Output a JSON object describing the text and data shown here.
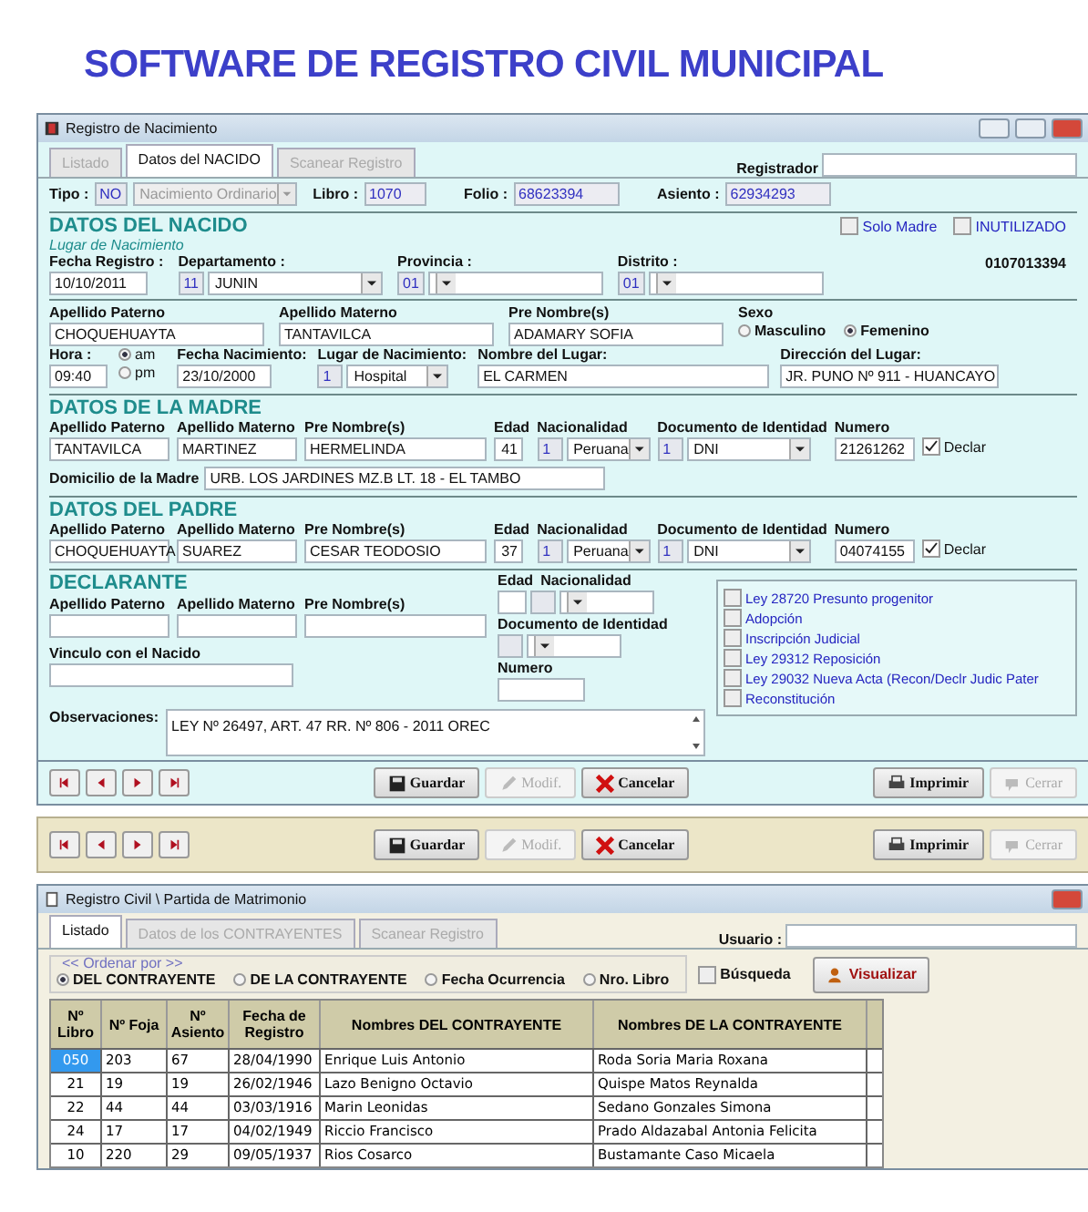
{
  "heading": "SOFTWARE DE REGISTRO CIVIL MUNICIPAL",
  "birth_window": {
    "title": "Registro de Nacimiento",
    "tabs": [
      {
        "label": "Listado",
        "selected": false
      },
      {
        "label": "Datos del NACIDO",
        "selected": true
      },
      {
        "label": "Scanear Registro",
        "selected": false
      }
    ],
    "registrador_label": "Registrador",
    "tipo": {
      "label": "Tipo :",
      "code": "NO",
      "value": "Nacimiento Ordinario"
    },
    "libro": {
      "label": "Libro :",
      "value": "1070"
    },
    "folio": {
      "label": "Folio :",
      "value": "68623394"
    },
    "asiento": {
      "label": "Asiento :",
      "value": "62934293"
    },
    "nacido": {
      "title": "DATOS DEL NACIDO",
      "checks": [
        {
          "label": "Solo Madre",
          "checked": false
        },
        {
          "label": "INUTILIZADO",
          "checked": false
        }
      ],
      "lugar_caption": "Lugar de Nacimiento",
      "record_code": "0107013394",
      "fecha_registro": {
        "label": "Fecha Registro :",
        "value": "10/10/2011"
      },
      "departamento": {
        "label": "Departamento :",
        "code": "11",
        "value": "JUNIN"
      },
      "provincia": {
        "label": "Provincia :",
        "code": "01"
      },
      "distrito": {
        "label": "Distrito :",
        "code": "01"
      },
      "names": [
        {
          "label": "Apellido Paterno",
          "value": "CHOQUEHUAYTA"
        },
        {
          "label": "Apellido Materno",
          "value": "TANTAVILCA"
        },
        {
          "label": "Pre Nombre(s)",
          "value": "ADAMARY SOFIA"
        }
      ],
      "sexo": {
        "label": "Sexo",
        "options": [
          {
            "label": "Masculino",
            "selected": false
          },
          {
            "label": "Femenino",
            "selected": true
          }
        ]
      },
      "hora": {
        "label": "Hora :",
        "value": "09:40",
        "options": [
          {
            "label": "am",
            "selected": true
          },
          {
            "label": "pm",
            "selected": false
          }
        ]
      },
      "fecha_nacimiento": {
        "label": "Fecha Nacimiento:",
        "value": "23/10/2000"
      },
      "lugar": {
        "label": "Lugar de Nacimiento:",
        "code": "1",
        "value": "Hospital"
      },
      "nombre_lugar": {
        "label": "Nombre del Lugar:",
        "value": "EL CARMEN"
      },
      "direccion": {
        "label": "Dirección del Lugar:",
        "value": "JR. PUNO Nº 911  -  HUANCAYO"
      }
    },
    "parents": [
      {
        "title": "DATOS DE LA MADRE",
        "apellido_paterno": {
          "label": "Apellido Paterno",
          "value": "TANTAVILCA"
        },
        "apellido_materno": {
          "label": "Apellido Materno",
          "value": "MARTINEZ"
        },
        "pre_nombres": {
          "label": "Pre Nombre(s)",
          "value": "HERMELINDA"
        },
        "edad": {
          "label": "Edad",
          "value": "41"
        },
        "nacionalidad": {
          "label": "Nacionalidad",
          "code": "1",
          "value": "Peruana"
        },
        "documento": {
          "label": "Documento de Identidad",
          "code": "1",
          "value": "DNI"
        },
        "numero": {
          "label": "Numero",
          "value": "21261262"
        },
        "declarante": {
          "label": "Declar",
          "checked": true
        },
        "domicilio": {
          "label": "Domicilio de la Madre",
          "value": "URB. LOS JARDINES  MZ.B  LT. 18  -  EL TAMBO"
        }
      },
      {
        "title": "DATOS DEL PADRE",
        "apellido_paterno": {
          "label": "Apellido Paterno",
          "value": "CHOQUEHUAYTA"
        },
        "apellido_materno": {
          "label": "Apellido Materno",
          "value": "SUAREZ"
        },
        "pre_nombres": {
          "label": "Pre Nombre(s)",
          "value": "CESAR TEODOSIO"
        },
        "edad": {
          "label": "Edad",
          "value": "37"
        },
        "nacionalidad": {
          "label": "Nacionalidad",
          "code": "1",
          "value": "Peruana"
        },
        "documento": {
          "label": "Documento de Identidad",
          "code": "1",
          "value": "DNI"
        },
        "numero": {
          "label": "Numero",
          "value": "04074155"
        },
        "declarante": {
          "label": "Declar",
          "checked": true
        }
      }
    ],
    "declarante": {
      "title": "DECLARANTE",
      "name_labels": [
        "Apellido Paterno",
        "Apellido Materno",
        "Pre Nombre(s)"
      ],
      "edad_label": "Edad",
      "nacionalidad_label": "Nacionalidad",
      "documento_label": "Documento de Identidad",
      "numero_label": "Numero",
      "vinculo_label": "Vinculo con el Nacido"
    },
    "observaciones": {
      "label": "Observaciones:",
      "value": "LEY Nº 26497,  ART. 47   RR. Nº 806 - 2011  OREC"
    },
    "legal_options": [
      {
        "label": "Ley 28720 Presunto progenitor",
        "checked": false
      },
      {
        "label": "Adopción",
        "checked": false
      },
      {
        "label": "Inscripción Judicial",
        "checked": false
      },
      {
        "label": "Ley 29312 Reposición",
        "checked": false
      },
      {
        "label": "Ley 29032 Nueva Acta (Recon/Declr Judic Pater",
        "checked": false
      },
      {
        "label": "Reconstitución",
        "checked": false
      }
    ],
    "actions": [
      {
        "kind": "save",
        "label": "Guardar",
        "disabled": false
      },
      {
        "kind": "edit",
        "label": "Modif.",
        "disabled": true
      },
      {
        "kind": "cancel",
        "label": "Cancelar",
        "disabled": false
      },
      {
        "kind": "print",
        "label": "Imprimir",
        "disabled": false
      },
      {
        "kind": "close",
        "label": "Cerrar",
        "disabled": true
      }
    ]
  },
  "bottom_toolbar": {
    "actions": [
      {
        "kind": "save",
        "label": "Guardar",
        "disabled": false
      },
      {
        "kind": "edit",
        "label": "Modif.",
        "disabled": true
      },
      {
        "kind": "cancel",
        "label": "Cancelar",
        "disabled": false
      },
      {
        "kind": "print",
        "label": "Imprimir",
        "disabled": false
      },
      {
        "kind": "close",
        "label": "Cerrar",
        "disabled": true
      }
    ]
  },
  "marriage_window": {
    "title": "Registro Civil \\ Partida de Matrimonio",
    "tabs": [
      {
        "label": "Listado",
        "selected": true
      },
      {
        "label": "Datos de los CONTRAYENTES",
        "selected": false
      },
      {
        "label": "Scanear Registro",
        "selected": false
      }
    ],
    "usuario_label": "Usuario :",
    "order_caption": "<< Ordenar por >>",
    "order_options": [
      {
        "label": "DEL CONTRAYENTE",
        "selected": true
      },
      {
        "label": "DE LA CONTRAYENTE",
        "selected": false
      },
      {
        "label": "Fecha Ocurrencia",
        "selected": false
      },
      {
        "label": "Nro. Libro",
        "selected": false
      }
    ],
    "busqueda": {
      "label": "Búsqueda",
      "checked": false
    },
    "visualizar_label": "Visualizar",
    "table": {
      "columns": [
        "Nº Libro",
        "Nº Foja",
        "Nº Asiento",
        "Fecha de Registro",
        "Nombres DEL CONTRAYENTE",
        "Nombres DE LA CONTRAYENTE"
      ],
      "rows": [
        {
          "selected": true,
          "cells": [
            "050",
            "203",
            "67",
            "28/04/1990",
            "Enrique Luis Antonio",
            "Roda Soria Maria Roxana"
          ]
        },
        {
          "selected": false,
          "cells": [
            "21",
            "19",
            "19",
            "26/02/1946",
            "Lazo Benigno Octavio",
            "Quispe Matos Reynalda"
          ]
        },
        {
          "selected": false,
          "cells": [
            "22",
            "44",
            "44",
            "03/03/1916",
            "Marin Leonidas",
            "Sedano Gonzales Simona"
          ]
        },
        {
          "selected": false,
          "cells": [
            "24",
            "17",
            "17",
            "04/02/1949",
            "Riccio Francisco",
            "Prado Aldazabal Antonia Felicita"
          ]
        },
        {
          "selected": false,
          "cells": [
            "10",
            "220",
            "29",
            "09/05/1937",
            "Rios Cosarco",
            "Bustamante Caso Micaela"
          ]
        }
      ]
    }
  }
}
